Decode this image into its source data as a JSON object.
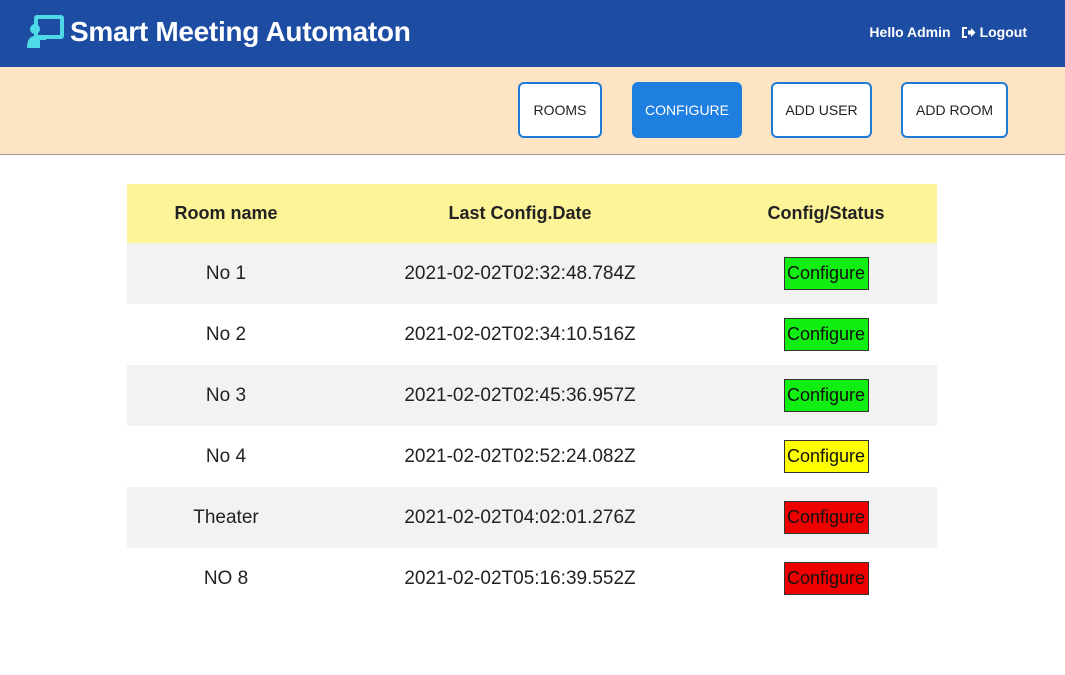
{
  "header": {
    "title": "Smart Meeting Automaton",
    "greeting": "Hello Admin",
    "logout_label": "Logout"
  },
  "nav": {
    "buttons": [
      {
        "label": "ROOMS",
        "active": false
      },
      {
        "label": "CONFIGURE",
        "active": true
      },
      {
        "label": "ADD USER",
        "active": false
      },
      {
        "label": "ADD ROOM",
        "active": false
      }
    ]
  },
  "table": {
    "columns": [
      "Room name",
      "Last Config.Date",
      "Config/Status"
    ],
    "rows": [
      {
        "room": "No 1",
        "date": "2021-02-02T02:32:48.784Z",
        "action": "Configure",
        "status_color": "#11ee11"
      },
      {
        "room": "No 2",
        "date": "2021-02-02T02:34:10.516Z",
        "action": "Configure",
        "status_color": "#11ee11"
      },
      {
        "room": "No 3",
        "date": "2021-02-02T02:45:36.957Z",
        "action": "Configure",
        "status_color": "#11ee11"
      },
      {
        "room": "No 4",
        "date": "2021-02-02T02:52:24.082Z",
        "action": "Configure",
        "status_color": "#ffff00"
      },
      {
        "room": "Theater",
        "date": "2021-02-02T04:02:01.276Z",
        "action": "Configure",
        "status_color": "#ee0000"
      },
      {
        "room": "NO 8",
        "date": "2021-02-02T05:16:39.552Z",
        "action": "Configure",
        "status_color": "#ee0000"
      }
    ]
  },
  "colors": {
    "header_bg": "#1d4ca3",
    "navbar_bg": "#fde4c2",
    "accent": "#1f7fe0",
    "table_header_bg": "#fdf397",
    "brand_icon": "#4fd9e6"
  }
}
